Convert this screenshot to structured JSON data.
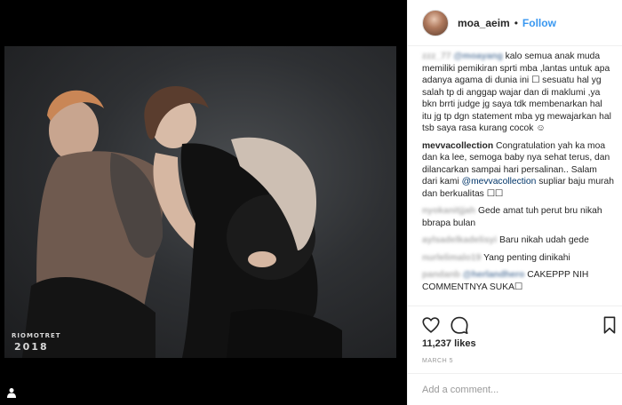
{
  "post": {
    "watermark": {
      "brand": "RIOMOTRET",
      "year": "2018"
    }
  },
  "header": {
    "username": "moa_aeim",
    "separator": "•",
    "follow_label": "Follow"
  },
  "comments": [
    {
      "user": "zzz_77",
      "blurred_user": true,
      "mention": "@moayang",
      "blurred_mention": true,
      "text": "kalo semua anak muda memiliki pemikiran sprti mba ,lantas untuk apa adanya agama di dunia ini ☐ sesuatu hal yg salah tp di anggap wajar dan di maklumi ,ya bkn brrti judge jg saya tdk membenarkan hal itu jg tp dgn statement mba yg mewajarkan hal tsb saya rasa kurang cocok ☺"
    },
    {
      "user": "mevvacollection",
      "blurred_user": false,
      "text": "Congratulation yah ka moa dan ka lee, semoga baby nya sehat terus, dan dilancarkan sampai hari persalinan.. Salam dari kami ",
      "mention": "@mevvacollection",
      "blurred_mention": false,
      "text_after": " supliar baju murah dan berkualitas ☐☐"
    },
    {
      "user": "nyokanitjjah",
      "blurred_user": true,
      "text": "Gede amat tuh perut bru nikah bbrapa bulan"
    },
    {
      "user": "aylsadelkadelisyi",
      "blurred_user": true,
      "text": "Baru nikah udah gede"
    },
    {
      "user": "nurlelimalo19",
      "blurred_user": true,
      "text": "Yang penting dinikahi"
    },
    {
      "user": "pandanb",
      "blurred_user": true,
      "mention": "@herlandhero",
      "blurred_mention": true,
      "text": "CAKEPPP NIH COMMENTNYA SUKA☐"
    }
  ],
  "actions": {
    "icons": [
      "heart-icon",
      "comment-icon",
      "bookmark-icon"
    ]
  },
  "likes": "11,237 likes",
  "date": "MARCH 5",
  "add_comment": {
    "placeholder": "Add a comment..."
  },
  "colors": {
    "accent": "#3897f0",
    "text": "#262626",
    "muted": "#999999",
    "border": "#efefef"
  }
}
